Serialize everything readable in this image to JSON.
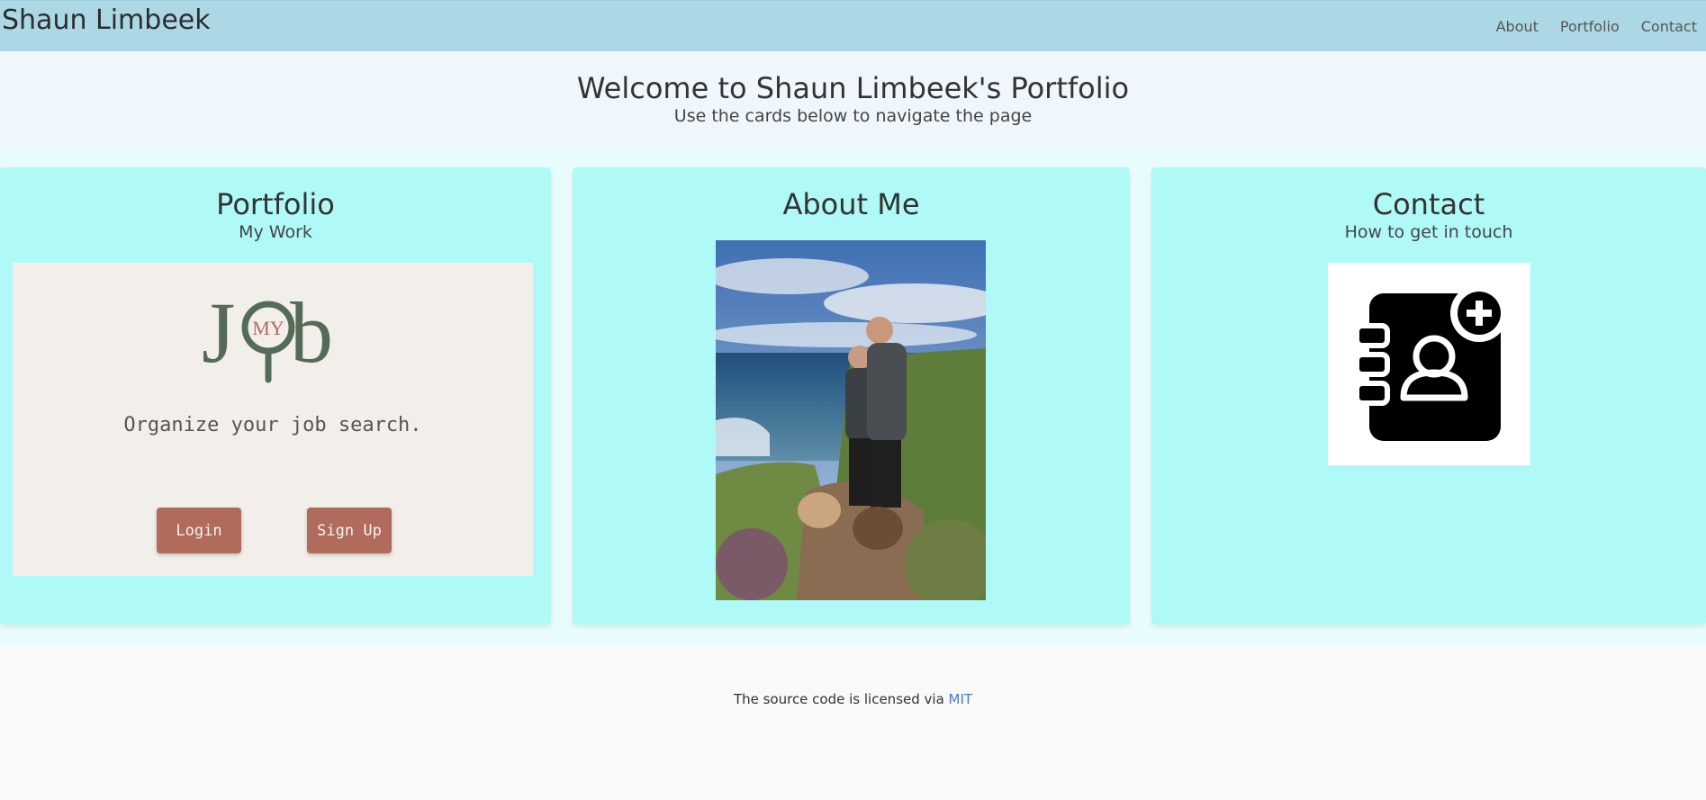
{
  "nav": {
    "brand": "Shaun Limbeek",
    "links": [
      "About",
      "Portfolio",
      "Contact"
    ]
  },
  "hero": {
    "title": "Welcome to Shaun Limbeek's Portfolio",
    "subtitle": "Use the cards below to navigate the page"
  },
  "cards": {
    "portfolio": {
      "title": "Portfolio",
      "subtitle": "My Work",
      "preview": {
        "logo_word": "Job",
        "logo_small": "MY",
        "tagline": "Organize your job search.",
        "login_label": "Login",
        "signup_label": "Sign Up"
      }
    },
    "about": {
      "title": "About Me"
    },
    "contact": {
      "title": "Contact",
      "subtitle": "How to get in touch",
      "icon": "contact-book-add-icon"
    }
  },
  "footer": {
    "text": "The source code is licensed via ",
    "link_text": "MIT"
  },
  "colors": {
    "navbar": "#acd8e5",
    "hero": "#eff7fd",
    "card": "#affaf7",
    "button": "#b06b5c",
    "link": "#4a79c7"
  }
}
